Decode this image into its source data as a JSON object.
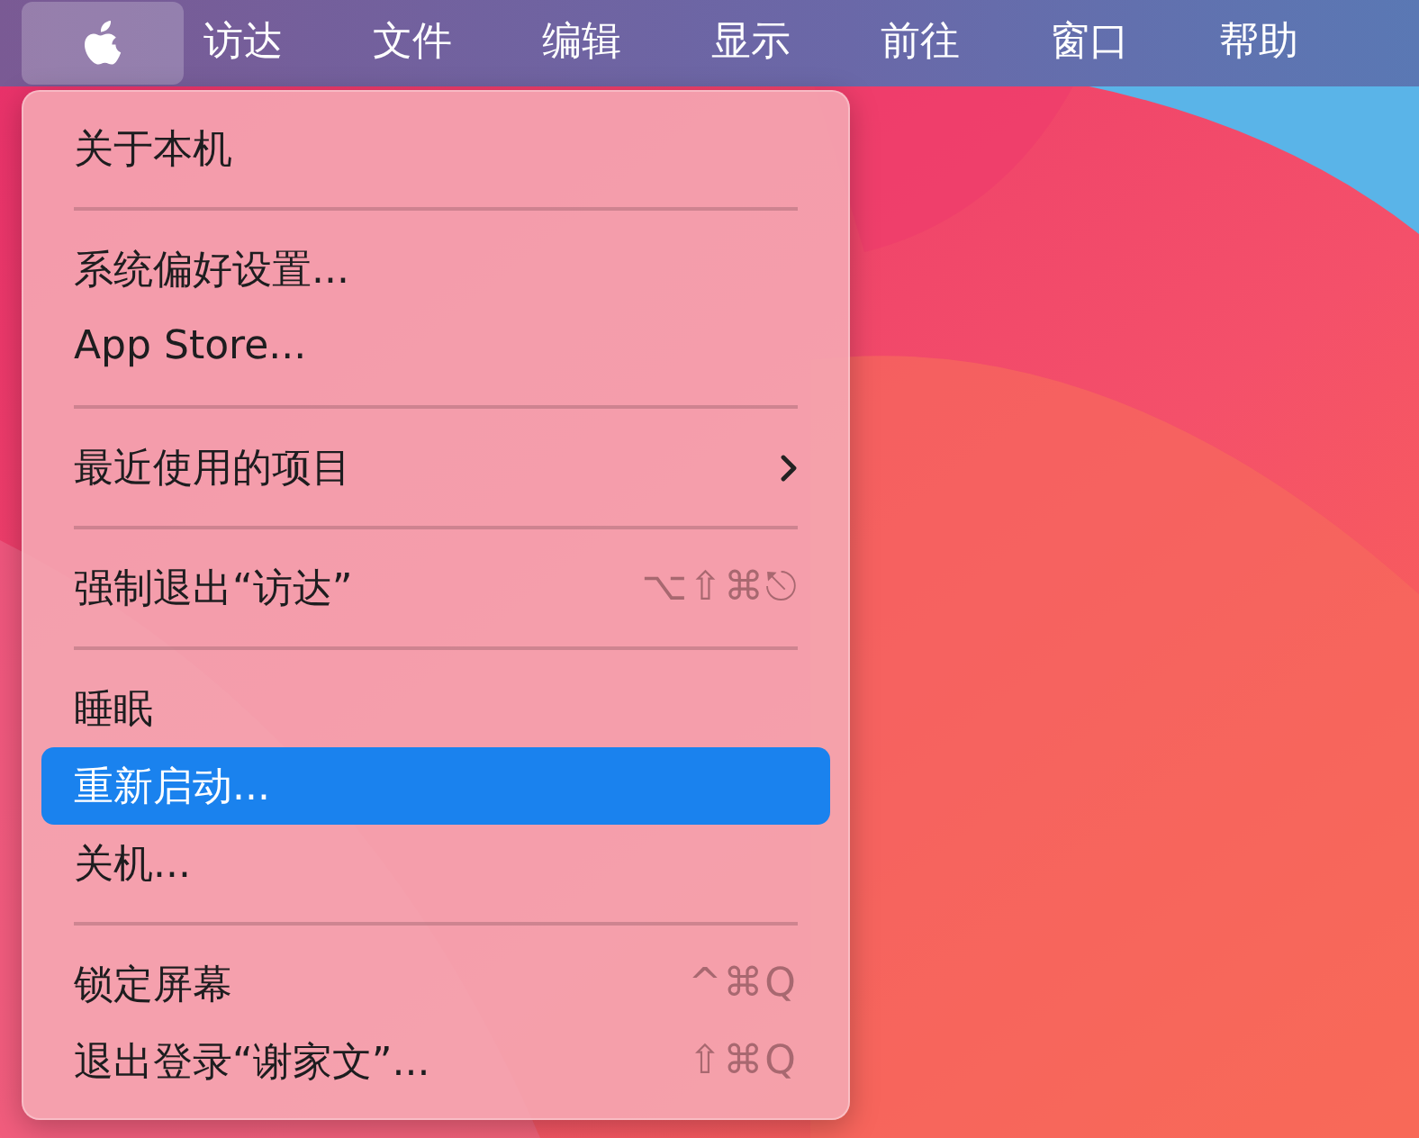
{
  "menu_bar": {
    "apple_selected": true,
    "items": [
      {
        "label": "访达",
        "selected": false
      },
      {
        "label": "文件",
        "selected": false
      },
      {
        "label": "编辑",
        "selected": false
      },
      {
        "label": "显示",
        "selected": false
      },
      {
        "label": "前往",
        "selected": false
      },
      {
        "label": "窗口",
        "selected": false
      },
      {
        "label": "帮助",
        "selected": false
      }
    ]
  },
  "apple_menu": {
    "items": [
      {
        "kind": "item",
        "label": "关于本机",
        "selected": false
      },
      {
        "kind": "separator"
      },
      {
        "kind": "item",
        "label": "系统偏好设置...",
        "selected": false
      },
      {
        "kind": "item",
        "label": "App Store...",
        "selected": false
      },
      {
        "kind": "separator"
      },
      {
        "kind": "item",
        "label": "最近使用的项目",
        "selected": false,
        "submenu": true
      },
      {
        "kind": "separator"
      },
      {
        "kind": "item",
        "label": "强制退出“访达”",
        "selected": false,
        "shortcut": "⌥⇧⌘⎋"
      },
      {
        "kind": "separator"
      },
      {
        "kind": "item",
        "label": "睡眠",
        "selected": false
      },
      {
        "kind": "item",
        "label": "重新启动...",
        "selected": true
      },
      {
        "kind": "item",
        "label": "关机...",
        "selected": false
      },
      {
        "kind": "separator"
      },
      {
        "kind": "item",
        "label": "锁定屏幕",
        "selected": false,
        "shortcut": "^⌘Q"
      },
      {
        "kind": "item",
        "label": "退出登录“谢家文”...",
        "selected": false,
        "shortcut": "⇧⌘Q"
      }
    ]
  }
}
